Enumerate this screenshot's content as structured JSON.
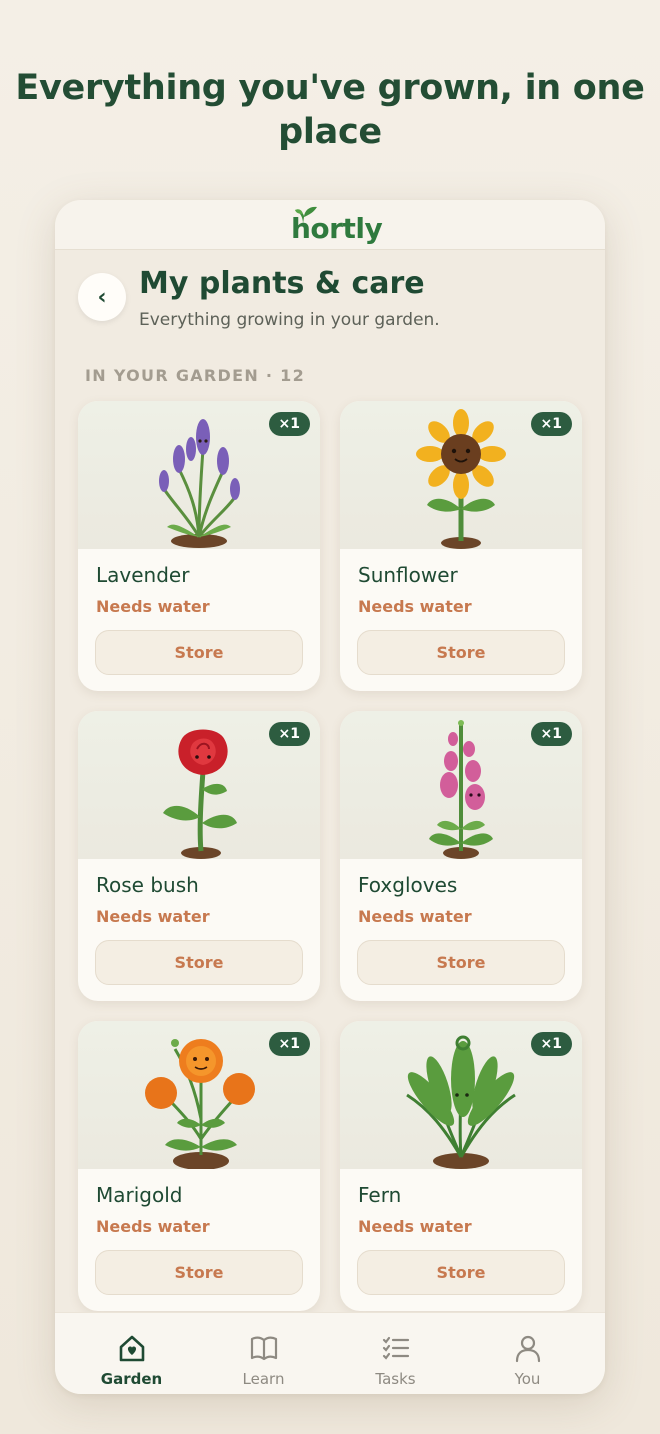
{
  "headline": "Everything you've grown, in one place",
  "app": {
    "logo": "hortly"
  },
  "header": {
    "back_label": "‹",
    "title": "My plants & care",
    "subtitle": "Everything growing in your garden."
  },
  "section": {
    "label": "IN YOUR GARDEN · 12"
  },
  "plants": [
    {
      "name": "Lavender",
      "status": "Needs water",
      "qty": "×1",
      "button": "Store",
      "icon": "lavender-plant"
    },
    {
      "name": "Sunflower",
      "status": "Needs water",
      "qty": "×1",
      "button": "Store",
      "icon": "sunflower-plant"
    },
    {
      "name": "Rose bush",
      "status": "Needs water",
      "qty": "×1",
      "button": "Store",
      "icon": "rose-plant"
    },
    {
      "name": "Foxgloves",
      "status": "Needs water",
      "qty": "×1",
      "button": "Store",
      "icon": "foxglove-plant"
    },
    {
      "name": "Marigold",
      "status": "Needs water",
      "qty": "×1",
      "button": "Store",
      "icon": "marigold-plant"
    },
    {
      "name": "Fern",
      "status": "Needs water",
      "qty": "×1",
      "button": "Store",
      "icon": "fern-plant"
    }
  ],
  "tabs": [
    {
      "label": "Garden",
      "icon": "house-heart-icon",
      "active": true
    },
    {
      "label": "Learn",
      "icon": "book-icon",
      "active": false
    },
    {
      "label": "Tasks",
      "icon": "checklist-icon",
      "active": false
    },
    {
      "label": "You",
      "icon": "user-icon",
      "active": false
    }
  ],
  "colors": {
    "brand_green": "#2f7a3e",
    "dark_green": "#1f4a33",
    "badge_green": "#2d5c40",
    "status_orange": "#c7794f",
    "background": "#f1ebe1"
  }
}
